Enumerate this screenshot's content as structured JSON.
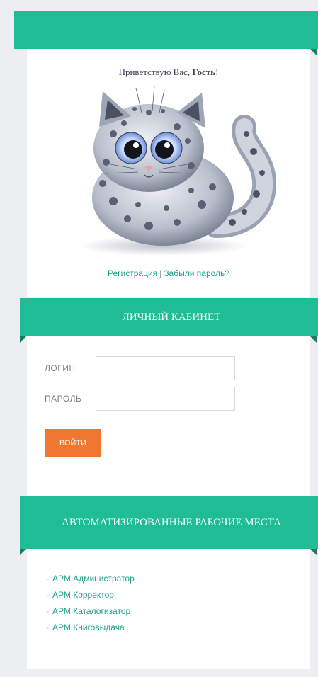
{
  "greeting": {
    "prefix": "Приветствую Вас, ",
    "user": "Гость",
    "suffix": "!"
  },
  "auth_links": {
    "register": "Регистрация",
    "separator": "|",
    "forgot": "Забыли пароль?"
  },
  "cabinet": {
    "title": "ЛИЧНЫЙ КАБИНЕТ",
    "login_label": "ЛОГИН",
    "password_label": "ПАРОЛЬ",
    "login_value": "",
    "password_value": "",
    "submit_label": "ВОЙТИ"
  },
  "workstations": {
    "title": "АВТОМАТИЗИРОВАННЫЕ РАБОЧИЕ МЕСТА",
    "items": [
      {
        "label": "АРМ Администратор"
      },
      {
        "label": "АРМ Корректор"
      },
      {
        "label": "АРМ Каталогизатор"
      },
      {
        "label": "АРМ Книговыдача"
      }
    ]
  },
  "colors": {
    "accent": "#1fbc96",
    "fold": "#157d63",
    "button": "#f0772f",
    "link": "#1fa386"
  },
  "icons": {
    "mascot": "snow-leopard-mascot",
    "bullet": "dash-bullet"
  }
}
